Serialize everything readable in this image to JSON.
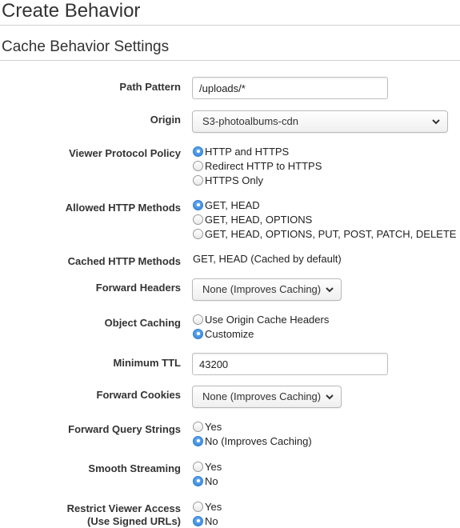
{
  "page": {
    "title": "Create Behavior",
    "section_title": "Cache Behavior Settings"
  },
  "fields": {
    "path_pattern": {
      "label": "Path Pattern",
      "value": "/uploads/*"
    },
    "origin": {
      "label": "Origin",
      "selected": "S3-photoalbums-cdn",
      "icon": "chevron-down-icon"
    },
    "viewer_protocol_policy": {
      "label": "Viewer Protocol Policy",
      "options": [
        "HTTP and HTTPS",
        "Redirect HTTP to HTTPS",
        "HTTPS Only"
      ],
      "selected_index": 0
    },
    "allowed_http_methods": {
      "label": "Allowed HTTP Methods",
      "options": [
        "GET, HEAD",
        "GET, HEAD, OPTIONS",
        "GET, HEAD, OPTIONS, PUT, POST, PATCH, DELETE"
      ],
      "selected_index": 0
    },
    "cached_http_methods": {
      "label": "Cached HTTP Methods",
      "value": "GET, HEAD (Cached by default)"
    },
    "forward_headers": {
      "label": "Forward Headers",
      "selected": "None (Improves Caching)",
      "icon": "chevron-down-icon"
    },
    "object_caching": {
      "label": "Object Caching",
      "options": [
        "Use Origin Cache Headers",
        "Customize"
      ],
      "selected_index": 1
    },
    "minimum_ttl": {
      "label": "Minimum TTL",
      "value": "43200"
    },
    "forward_cookies": {
      "label": "Forward Cookies",
      "selected": "None (Improves Caching)",
      "icon": "chevron-down-icon"
    },
    "forward_query_strings": {
      "label": "Forward Query Strings",
      "options": [
        "Yes",
        "No (Improves Caching)"
      ],
      "selected_index": 1
    },
    "smooth_streaming": {
      "label": "Smooth Streaming",
      "options": [
        "Yes",
        "No"
      ],
      "selected_index": 1
    },
    "restrict_viewer_access": {
      "label_line1": "Restrict Viewer Access",
      "label_line2": "(Use Signed URLs)",
      "options": [
        "Yes",
        "No"
      ],
      "selected_index": 1
    }
  },
  "colors": {
    "radio_selected": "#2f7fd6",
    "divider": "#d0d0d0",
    "heading_text": "#333333"
  }
}
